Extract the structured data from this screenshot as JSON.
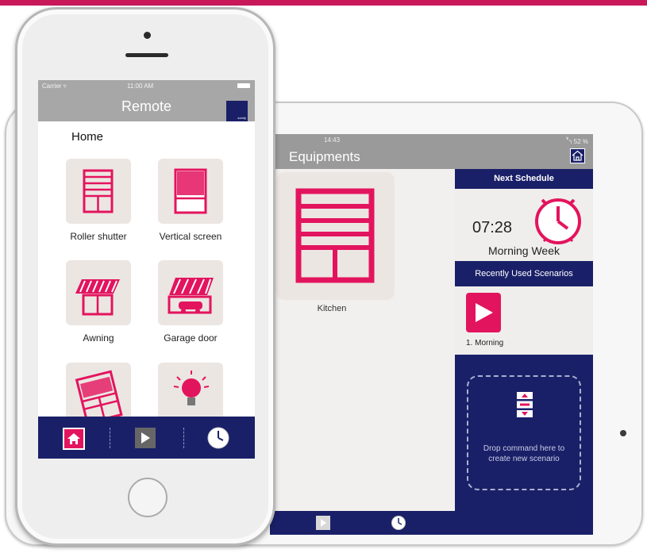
{
  "colors": {
    "accent": "#e3145e",
    "navy": "#1a2068",
    "header_gray": "#9a9a9a",
    "tile_bg": "#ece6e3"
  },
  "tablet": {
    "status_time": "14:43",
    "status_battery": "ัำ 52 %",
    "header_title": "Equipments",
    "equipment": {
      "label": "Kitchen",
      "icon": "roller-shutter-icon"
    },
    "next_schedule": {
      "heading": "Next Schedule",
      "time": "07:28",
      "name": "Morning Week"
    },
    "recent": {
      "heading": "Recently Used Scenarios",
      "items": [
        {
          "label": "1. Morning"
        }
      ]
    },
    "drop_zone_text": "Drop command here to create new scenario",
    "tabs": [
      "play-icon",
      "clock-icon"
    ]
  },
  "phone": {
    "status_carrier": "Carrier ▿",
    "status_time": "11:00 AM",
    "header_title": "Remote",
    "logo_text": "somfy",
    "home_title": "Home",
    "tiles": [
      {
        "label": "Roller shutter",
        "icon": "roller-shutter-icon"
      },
      {
        "label": "Vertical screen",
        "icon": "vertical-screen-icon"
      },
      {
        "label": "Awning",
        "icon": "awning-icon"
      },
      {
        "label": "Garage door",
        "icon": "garage-door-icon"
      },
      {
        "label": "",
        "icon": "window-icon"
      },
      {
        "label": "",
        "icon": "light-bulb-icon"
      }
    ],
    "tabs": [
      "home-icon",
      "play-icon",
      "clock-icon"
    ]
  }
}
